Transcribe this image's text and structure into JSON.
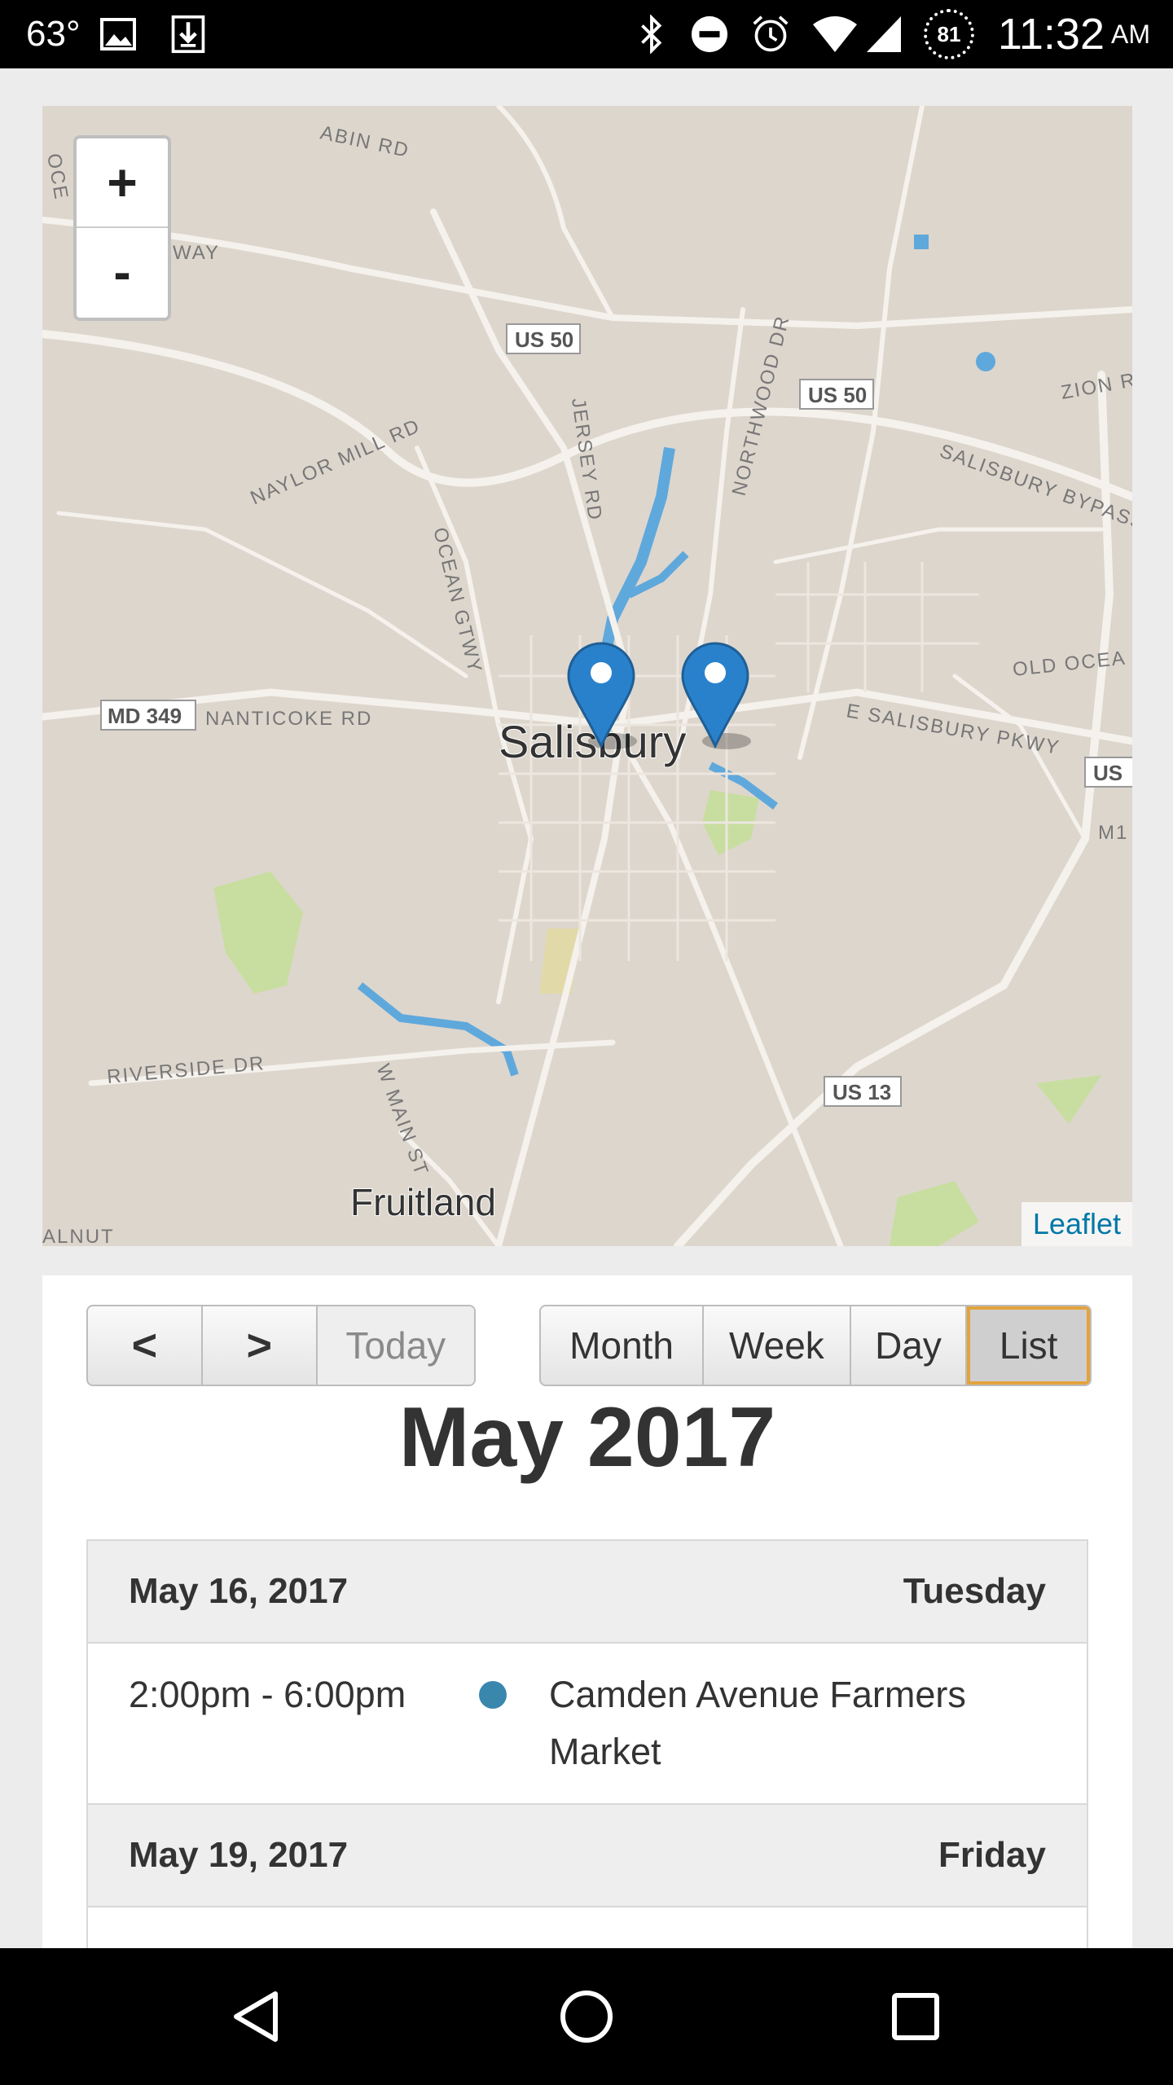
{
  "status_bar": {
    "temperature": "63°",
    "battery": "81",
    "time": "11:32",
    "ampm": "AM",
    "icons": [
      "image-icon",
      "download-icon",
      "bluetooth-icon",
      "do-not-disturb-icon",
      "alarm-icon",
      "wifi-icon",
      "signal-icon",
      "battery-icon"
    ]
  },
  "map": {
    "zoom_in": "+",
    "zoom_out": "-",
    "attribution": "Leaflet",
    "labels": {
      "city": "Salisbury",
      "fruitland": "Fruitland",
      "us50_a": "US 50",
      "us50_b": "US 50",
      "us13": "US 13",
      "md349": "MD 349",
      "nanticoke": "NANTICOKE RD",
      "naylor": "NAYLOR MILL RD",
      "jersey": "JERSEY RD",
      "ocean_gtwy": "OCEAN GTWY",
      "northwood": "NORTHWOOD DR",
      "bypass": "SALISBURY BYPASS",
      "zion": "ZION R",
      "old_ocean": "OLD OCEA",
      "e_salisbury": "E SALISBURY PKWY",
      "riverside": "RIVERSIDE DR",
      "w_main": "W MAIN ST",
      "cabin": "ABIN RD",
      "way": "WAY",
      "walnut": "ALNUT",
      "us_edge": "US",
      "m1": "M1",
      "oce": "OCE"
    }
  },
  "calendar": {
    "nav": {
      "prev": "<",
      "next": ">",
      "today": "Today"
    },
    "views": {
      "month": "Month",
      "week": "Week",
      "day": "Day",
      "list": "List"
    },
    "title": "May 2017",
    "days": [
      {
        "date": "May 16, 2017",
        "weekday": "Tuesday",
        "events": [
          {
            "time": "2:00pm - 6:00pm",
            "title": "Camden Avenue Farmers Market",
            "color": "#3a87ad"
          }
        ]
      },
      {
        "date": "May 19, 2017",
        "weekday": "Friday",
        "events": []
      }
    ]
  }
}
